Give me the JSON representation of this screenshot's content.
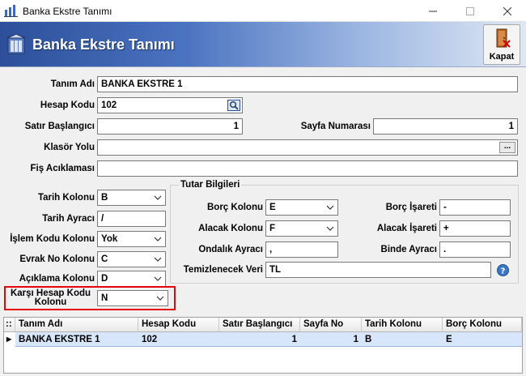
{
  "window": {
    "title": "Banka Ekstre Tanımı"
  },
  "header": {
    "title": "Banka Ekstre Tanımı",
    "close_label": "Kapat"
  },
  "form": {
    "tanim_adi": {
      "label": "Tanım Adı",
      "value": "BANKA EKSTRE 1"
    },
    "hesap_kodu": {
      "label": "Hesap Kodu",
      "value": "102"
    },
    "satir_baslangici": {
      "label": "Satır Başlangıcı",
      "value": "1"
    },
    "sayfa_numarasi": {
      "label": "Sayfa Numarası",
      "value": "1"
    },
    "klasor_yolu": {
      "label": "Klasör Yolu",
      "value": "",
      "browse_label": "..."
    },
    "fis_aciklamasi": {
      "label": "Fiş Acıklaması",
      "value": ""
    },
    "tarih_kolonu": {
      "label": "Tarih Kolonu",
      "value": "B"
    },
    "tarih_ayraci": {
      "label": "Tarih Ayracı",
      "value": "/"
    },
    "islem_kodu_kolonu": {
      "label": "İşlem Kodu Kolonu",
      "value": "Yok"
    },
    "evrak_no_kolonu": {
      "label": "Evrak No Kolonu",
      "value": "C"
    },
    "aciklama_kolonu": {
      "label": "Açıklama Kolonu",
      "value": "D"
    },
    "karsi_hesap_kodu_kolonu": {
      "label_line1": "Karşı Hesap Kodu",
      "label_line2": "Kolonu",
      "value": "N"
    }
  },
  "tutar": {
    "title": "Tutar Bilgileri",
    "borc_kolonu": {
      "label": "Borç Kolonu",
      "value": "E"
    },
    "borc_isareti": {
      "label": "Borç İşareti",
      "value": "-"
    },
    "alacak_kolonu": {
      "label": "Alacak Kolonu",
      "value": "F"
    },
    "alacak_isareti": {
      "label": "Alacak İşareti",
      "value": "+"
    },
    "ondalik_ayraci": {
      "label": "Ondalık Ayracı",
      "value": ","
    },
    "binde_ayraci": {
      "label": "Binde Ayracı",
      "value": "."
    },
    "temizlenecek_veri": {
      "label": "Temizlenecek Veri",
      "value": "TL"
    }
  },
  "grid": {
    "corner": "::",
    "columns": [
      "Tanım Adı",
      "Hesap Kodu",
      "Satır Başlangıcı",
      "Sayfa No",
      "Tarih Kolonu",
      "Borç Kolonu"
    ],
    "rows": [
      {
        "marker": "▶",
        "cells": [
          "BANKA EKSTRE 1",
          "102",
          "1",
          "1",
          "B",
          "E"
        ]
      }
    ]
  },
  "colors": {
    "highlight": "#e8000b",
    "header_start": "#2d4f9a",
    "selected_row": "#d7e6fb"
  }
}
